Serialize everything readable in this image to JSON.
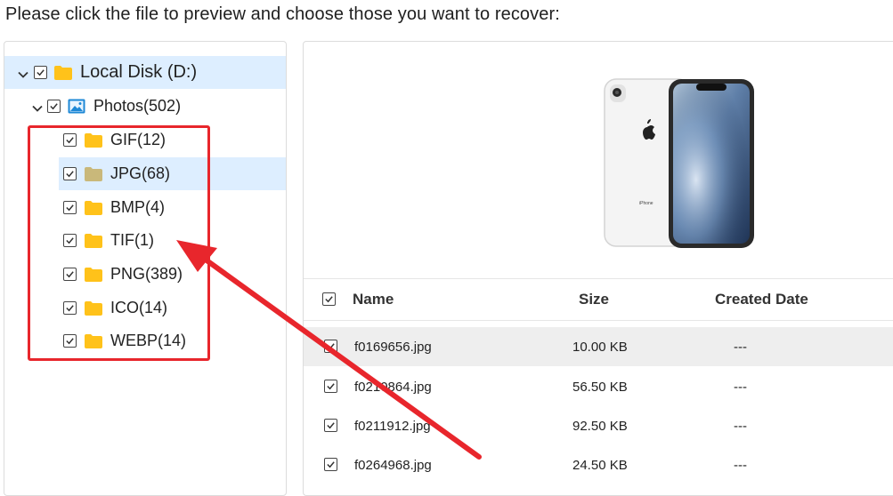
{
  "instruction": "Please click the file to preview and choose those you want to recover:",
  "tree": {
    "root": {
      "label": "Local Disk (D:)",
      "checked": true,
      "expanded": true
    },
    "photos": {
      "label": "Photos(502)",
      "checked": true,
      "expanded": true
    },
    "items": [
      {
        "label": "GIF(12)",
        "checked": true
      },
      {
        "label": "JPG(68)",
        "checked": true,
        "selected": true
      },
      {
        "label": "BMP(4)",
        "checked": true
      },
      {
        "label": "TIF(1)",
        "checked": true
      },
      {
        "label": "PNG(389)",
        "checked": true
      },
      {
        "label": "ICO(14)",
        "checked": true
      },
      {
        "label": "WEBP(14)",
        "checked": true
      }
    ]
  },
  "preview": {
    "phone_text": "iPhone"
  },
  "table": {
    "headers": {
      "name": "Name",
      "size": "Size",
      "created": "Created Date"
    },
    "rows": [
      {
        "name": "f0169656.jpg",
        "size": "10.00 KB",
        "created": "---"
      },
      {
        "name": "f0210864.jpg",
        "size": "56.50 KB",
        "created": "---"
      },
      {
        "name": "f0211912.jpg",
        "size": "92.50 KB",
        "created": "---"
      },
      {
        "name": "f0264968.jpg",
        "size": "24.50 KB",
        "created": "---"
      }
    ]
  },
  "colors": {
    "accent_red": "#e8262c",
    "selection_blue": "#ddeeff",
    "folder_yellow": "#ffc21a",
    "folder_selected": "#c9b87a"
  }
}
